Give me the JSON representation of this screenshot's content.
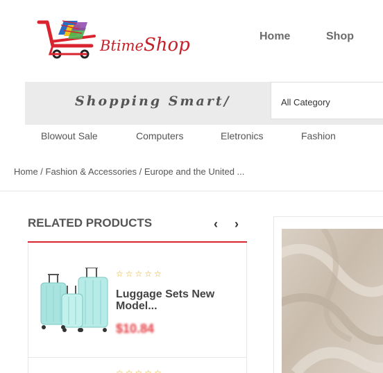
{
  "header": {
    "logo_text_a": "Btime",
    "logo_text_b": "Shop",
    "nav": [
      "Home",
      "Shop"
    ]
  },
  "search": {
    "slogan": "Shopping Smart/",
    "category": "All Category"
  },
  "category_menu": [
    "Blowout Sale",
    "Computers",
    "Eletronics",
    "Fashion"
  ],
  "breadcrumb": "Home / Fashion & Accessories / Europe and the United ...",
  "related": {
    "title": "RELATED PRODUCTS",
    "prev": "‹",
    "next": "›",
    "products": [
      {
        "name": "Luggage Sets New Model...",
        "price": "$10.84",
        "stars": "☆☆☆☆☆"
      },
      {
        "stars": "☆☆☆☆☆"
      }
    ]
  },
  "colors": {
    "brand_red": "#c5202a",
    "price_red": "#e2383f",
    "star": "#e8a91d"
  },
  "icons": {
    "logo": "shopping-cart-icon",
    "luggage": "luggage-icon"
  }
}
